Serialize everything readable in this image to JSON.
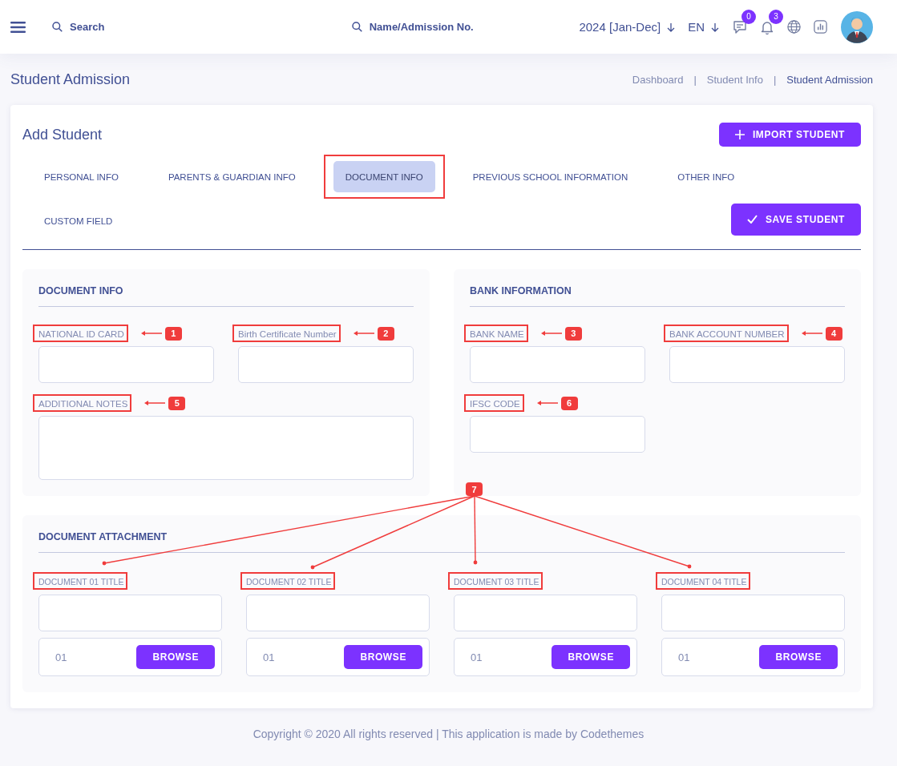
{
  "header": {
    "search": {
      "placeholder": "Search"
    },
    "admission_search": {
      "placeholder": "Name/Admission No."
    },
    "session": "2024 [Jan-Dec]",
    "language": "EN",
    "messages_count": "0",
    "notifications_count": "3"
  },
  "page_title": "Student Admission",
  "breadcrumb": [
    {
      "kind": "link",
      "text": "Dashboard"
    },
    {
      "kind": "separator",
      "text": "|"
    },
    {
      "kind": "link",
      "text": "Student Info"
    },
    {
      "kind": "separator",
      "text": "|"
    },
    {
      "kind": "current",
      "text": "Student Admission"
    }
  ],
  "card": {
    "title": "Add Student",
    "import_button": "IMPORT STUDENT",
    "save_button": "SAVE STUDENT",
    "tabs": [
      {
        "label": "PERSONAL INFO",
        "selected": false,
        "highlighted": false
      },
      {
        "label": "PARENTS & GUARDIAN INFO",
        "selected": false,
        "highlighted": false
      },
      {
        "label": "DOCUMENT INFO",
        "selected": true,
        "highlighted": true
      },
      {
        "label": "PREVIOUS SCHOOL INFORMATION",
        "selected": false,
        "highlighted": false
      },
      {
        "label": "OTHER INFO",
        "selected": false,
        "highlighted": false
      },
      {
        "label": "CUSTOM FIELD",
        "selected": false,
        "highlighted": false
      }
    ]
  },
  "sections": [
    {
      "title": "DOCUMENT INFO",
      "fields": [
        {
          "label": "NATIONAL ID CARD",
          "kind": "input",
          "highlighted": true,
          "callout": "1"
        },
        {
          "label": "Birth Certificate Number",
          "kind": "input",
          "highlighted": true,
          "callout": "2"
        },
        {
          "label": "ADDITIONAL NOTES",
          "kind": "textarea",
          "highlighted": true,
          "callout": "5"
        }
      ]
    },
    {
      "title": "BANK INFORMATION",
      "fields": [
        {
          "label": "BANK NAME",
          "kind": "input",
          "highlighted": true,
          "callout": "3"
        },
        {
          "label": "BANK ACCOUNT NUMBER",
          "kind": "input",
          "highlighted": true,
          "callout": "4"
        },
        {
          "label": "IFSC CODE",
          "kind": "input",
          "highlighted": true,
          "callout": "6"
        }
      ]
    }
  ],
  "attachment": {
    "title": "DOCUMENT ATTACHMENT",
    "callout": "7",
    "documents": [
      {
        "label": "DOCUMENT 01 TITLE",
        "highlighted": true,
        "file_placeholder": "01",
        "button": "BROWSE"
      },
      {
        "label": "DOCUMENT 02 TITLE",
        "highlighted": true,
        "file_placeholder": "01",
        "button": "BROWSE"
      },
      {
        "label": "DOCUMENT 03 TITLE",
        "highlighted": true,
        "file_placeholder": "01",
        "button": "BROWSE"
      },
      {
        "label": "DOCUMENT 04 TITLE",
        "highlighted": true,
        "file_placeholder": "01",
        "button": "BROWSE"
      }
    ]
  },
  "footer": "Copyright © 2020 All rights reserved | This application is made by Codethemes"
}
